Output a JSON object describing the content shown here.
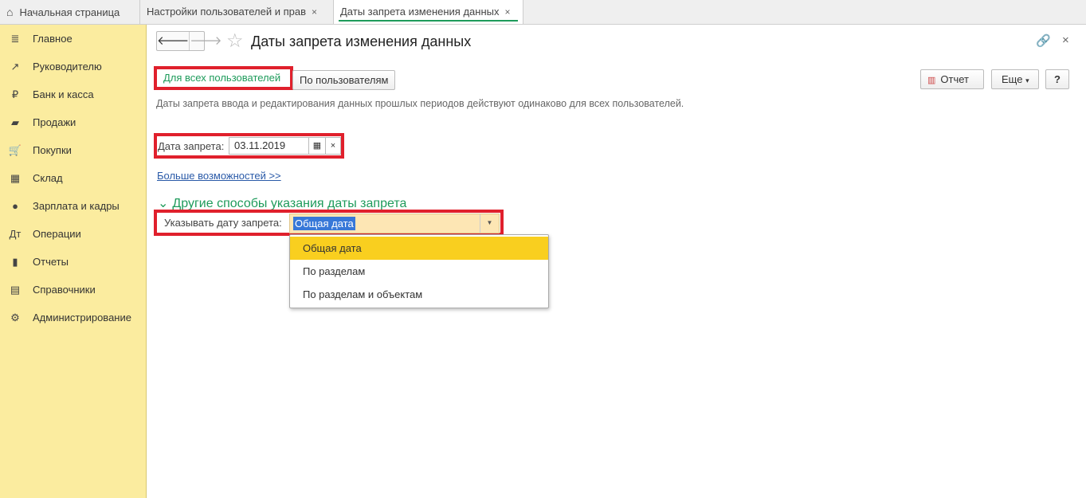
{
  "tabs": [
    {
      "label": "Начальная страница",
      "icon": "home-icon"
    },
    {
      "label": "Настройки пользователей и прав",
      "close": "×"
    },
    {
      "label": "Даты запрета изменения данных",
      "close": "×"
    }
  ],
  "sidebar": {
    "items": [
      {
        "label": "Главное",
        "icon": "≣"
      },
      {
        "label": "Руководителю",
        "icon": "↗"
      },
      {
        "label": "Банк и касса",
        "icon": "₽"
      },
      {
        "label": "Продажи",
        "icon": "▰"
      },
      {
        "label": "Покупки",
        "icon": "🛒"
      },
      {
        "label": "Склад",
        "icon": "▦"
      },
      {
        "label": "Зарплата и кадры",
        "icon": "●"
      },
      {
        "label": "Операции",
        "icon": "Дт"
      },
      {
        "label": "Отчеты",
        "icon": "▮"
      },
      {
        "label": "Справочники",
        "icon": "▤"
      },
      {
        "label": "Администрирование",
        "icon": "⚙"
      }
    ]
  },
  "header": {
    "back": "🡐",
    "forward": "🡒",
    "star": "☆",
    "title": "Даты запрета изменения данных",
    "link": "🔗",
    "close": "×"
  },
  "toolbar": {
    "all_users": "Для всех пользователей",
    "by_users": "По пользователям",
    "report": "Отчет",
    "more": "Еще",
    "more_arrow": "▾",
    "help": "?"
  },
  "description": "Даты запрета ввода и редактирования данных прошлых периодов действуют одинаково для всех пользователей.",
  "date_field": {
    "label": "Дата запрета:",
    "value": "03.11.2019",
    "calendar": "▦",
    "clear": "×"
  },
  "more_link": "Больше возможностей >>",
  "group": {
    "chevron": "⌄",
    "title": "Другие способы указания даты запрета"
  },
  "mode_field": {
    "label": "Указывать дату запрета:",
    "value": "Общая дата",
    "arrow": "▼"
  },
  "dropdown": {
    "options": [
      "Общая дата",
      "По разделам",
      "По разделам и объектам"
    ]
  },
  "colors": {
    "accent": "#1e9b5b",
    "sidebar": "#fbec9f",
    "highlight": "#f9cf1f",
    "annotation": "#e0202c"
  }
}
